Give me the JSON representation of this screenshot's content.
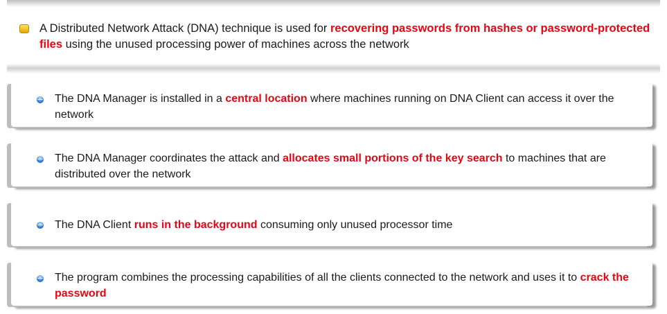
{
  "intro": {
    "pre": "A Distributed Network Attack (DNA) technique is used for ",
    "highlight": "recovering passwords from hashes or password-protected files",
    "post": " using the unused processing power of machines across the network"
  },
  "points": [
    {
      "pre": "The DNA Manager is installed in a ",
      "highlight": "central location",
      "post": " where machines running on DNA Client can access it over the network"
    },
    {
      "pre": "The DNA Manager coordinates the attack and ",
      "highlight": "allocates small portions of the key search",
      "post": " to machines that are distributed over the network"
    },
    {
      "pre": "The DNA Client ",
      "highlight": "runs in the background",
      "post": " consuming only unused processor time"
    },
    {
      "pre": "The program combines the processing capabilities of all the clients connected to the network and uses it to ",
      "highlight": "crack the password",
      "post": ""
    }
  ],
  "colors": {
    "highlight": "#e30613",
    "bullet_square": "#f2c200",
    "bullet_dot": "#2f7ad9"
  }
}
